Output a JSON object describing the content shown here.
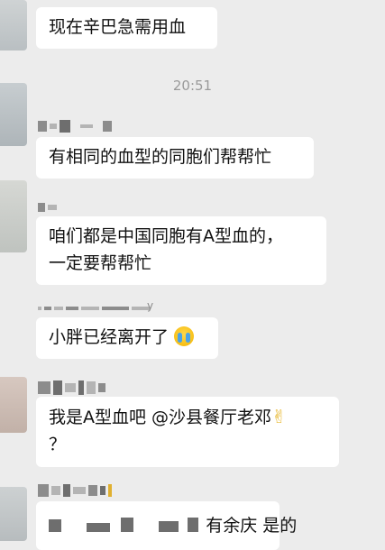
{
  "messages": [
    {
      "text": "现在辛巴急需用血"
    },
    {
      "text": "有相同的血型的同胞们帮帮忙"
    },
    {
      "line1": "咱们都是中国同胞有A型血的，",
      "line2": "一定要帮帮忙"
    },
    {
      "text": "小胖已经离开了",
      "emoji": "crying-face"
    },
    {
      "line1": "我是A型血吧 @沙县餐厅老邓",
      "emoji": "victory-hand",
      "line2": "？"
    },
    {
      "text": "有余庆 是的"
    }
  ],
  "timestamp": "20:51",
  "sender_fragment": "y",
  "emoji_glyphs": {
    "victory": "✌"
  },
  "colors": {
    "background": "#ececec",
    "bubble": "#ffffff",
    "timestamp": "#9a9a9a"
  }
}
